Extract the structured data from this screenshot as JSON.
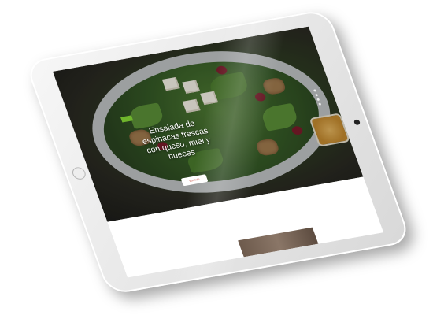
{
  "hero": {
    "title": "Ensalada de espinacas frescas con queso, miel y nueces",
    "button_label": "VER MÁS",
    "slide_count": 4
  },
  "colors": {
    "device_frame": "#e9e9e9",
    "accent_green": "#6fb52c",
    "button_text": "#c0392b",
    "hero_text": "#ffffff"
  },
  "icons": {
    "camera": "camera-icon",
    "home_button": "home-button-icon"
  }
}
